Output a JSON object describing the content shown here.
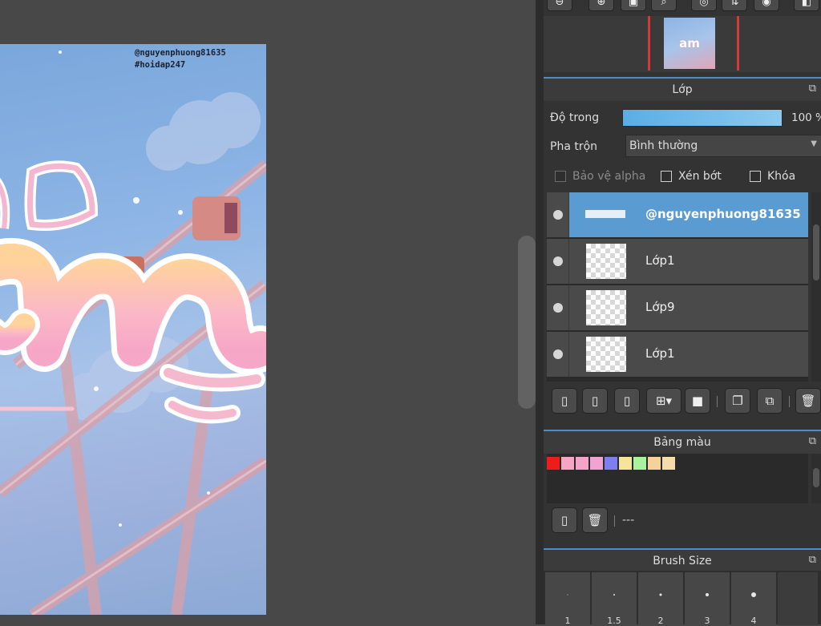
{
  "canvas": {
    "watermark_line1": "@nguyenphuong81635",
    "watermark_line2": "#hoidap247",
    "art_text": "m"
  },
  "navigator": {
    "thumb_text": "am"
  },
  "toolbar": {
    "icons": [
      "zoom-out-icon",
      "zoom-in-icon",
      "fit-icon",
      "zoom-icon",
      "rotate-icon",
      "flip-icon",
      "reset-icon",
      "split-icon"
    ]
  },
  "layer_panel": {
    "title": "Lớp",
    "opacity_label": "Độ trong",
    "opacity_value": "100 %",
    "opacity": 1.0,
    "blend_label": "Pha trộn",
    "blend_value": "Bình thường",
    "protect_alpha": "Bảo vệ alpha",
    "clipping": "Xén bớt",
    "lock": "Khóa",
    "layers": [
      {
        "name": "@nguyenphuong81635",
        "selected": true
      },
      {
        "name": "Lớp1",
        "selected": false
      },
      {
        "name": "Lớp9",
        "selected": false
      },
      {
        "name": "Lớp1",
        "selected": false
      }
    ],
    "gear_glyph": "❄"
  },
  "palette_panel": {
    "title": "Bảng màu",
    "swatches": [
      "#f01c1c",
      "#f6a6c2",
      "#f4a4c8",
      "#f2a3d4",
      "#7d7ef0",
      "#f6e49c",
      "#a9f29e",
      "#f6d19c",
      "#f6dcac"
    ],
    "name_text": "---"
  },
  "brush_panel": {
    "title": "Brush Size",
    "sizes": [
      "1",
      "1.5",
      "2",
      "3",
      "4"
    ]
  }
}
